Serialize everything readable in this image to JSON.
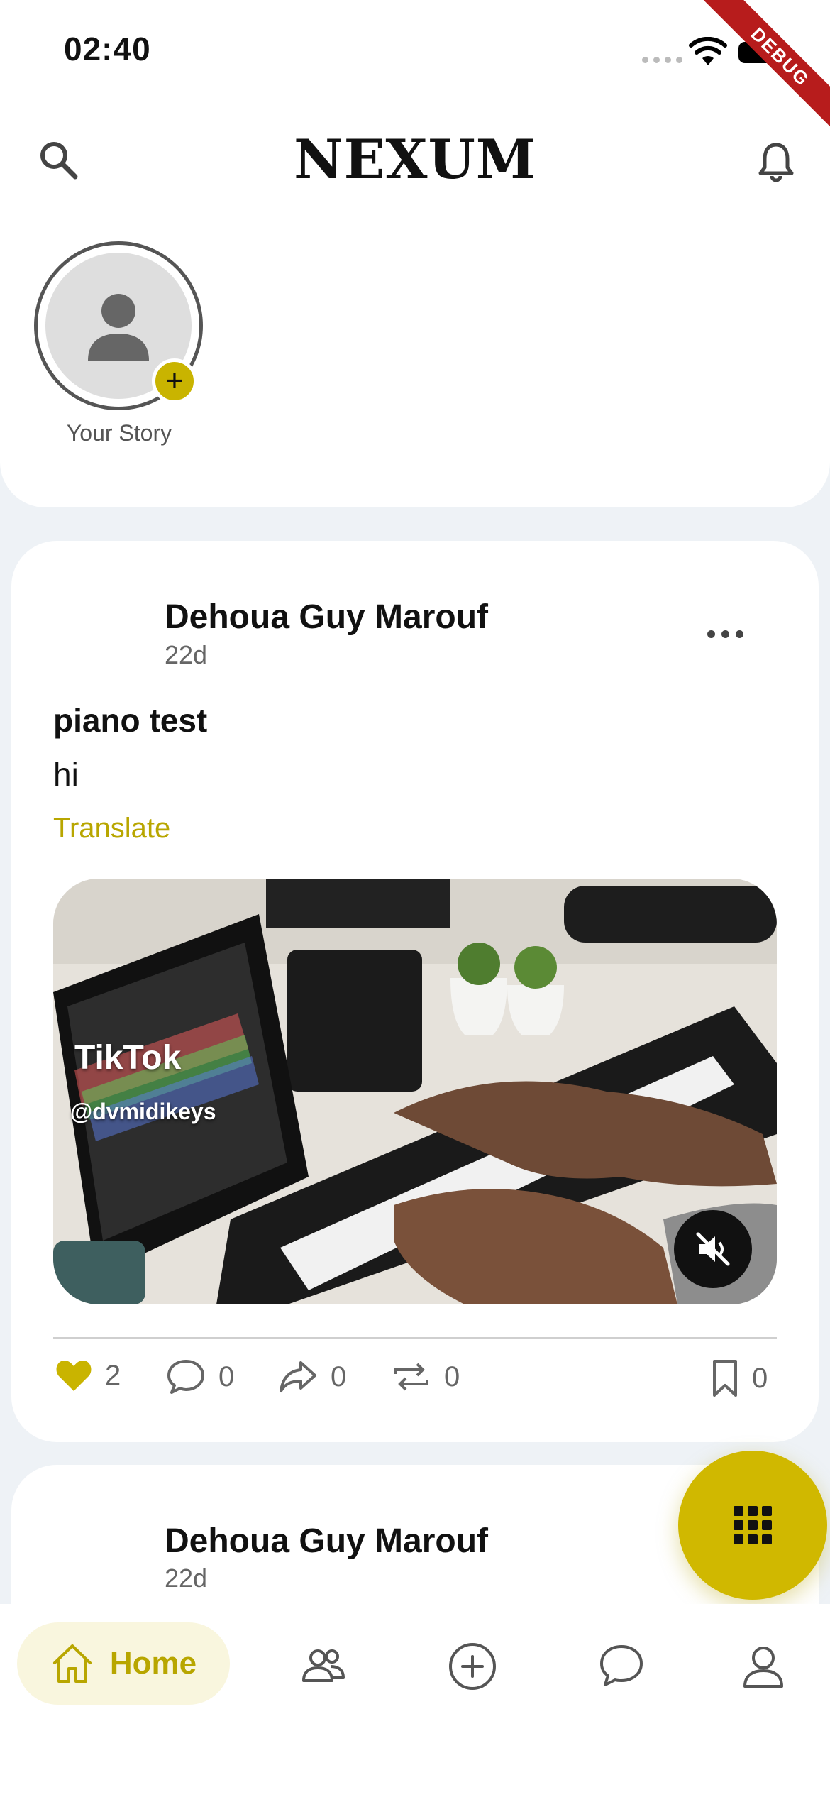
{
  "status_bar": {
    "time": "02:40",
    "debug_label": "DEBUG"
  },
  "app_bar": {
    "title": "NEXUM"
  },
  "stories": {
    "your_story_label": "Your Story",
    "add_symbol": "+"
  },
  "posts": [
    {
      "author": "Dehoua Guy Marouf",
      "age": "22d",
      "title": "piano test",
      "body": "hi",
      "translate_label": "Translate",
      "media": {
        "watermark_brand": "TikTok",
        "watermark_handle": "@dvmidikeys",
        "muted": true
      },
      "stats": {
        "likes": "2",
        "comments": "0",
        "shares": "0",
        "reposts": "0",
        "saves": "0"
      },
      "liked": true
    },
    {
      "author": "Dehoua Guy Marouf",
      "age": "22d"
    }
  ],
  "bottom_nav": {
    "items": [
      {
        "label": "Home",
        "icon": "home-icon",
        "active": true
      },
      {
        "icon": "friends-icon"
      },
      {
        "icon": "add-circle-icon"
      },
      {
        "icon": "chat-icon"
      },
      {
        "icon": "profile-icon"
      }
    ]
  },
  "colors": {
    "accent": "#c9b400",
    "accent_text": "#b8a600",
    "background": "#eef2f6"
  }
}
